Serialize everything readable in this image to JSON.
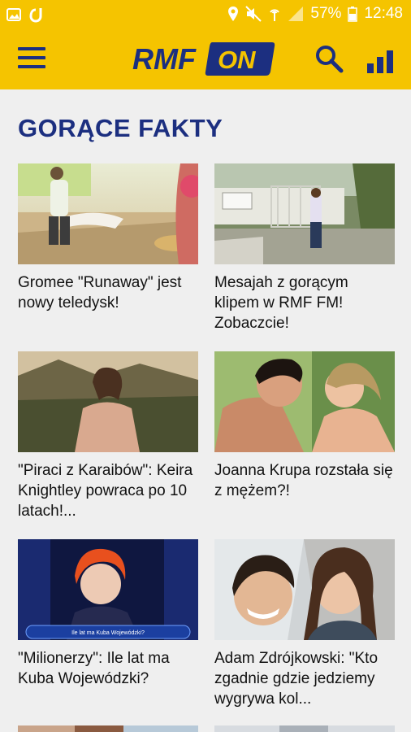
{
  "status_bar": {
    "battery": "57%",
    "time": "12:48"
  },
  "app": {
    "logo_rmf": "RMF",
    "logo_on": "ON",
    "colors": {
      "brand_yellow": "#f5c400",
      "brand_blue": "#1c2f80"
    }
  },
  "section": {
    "title": "GORĄCE FAKTY"
  },
  "articles": [
    {
      "title": "Gromee \"Runaway\" jest nowy teledysk!"
    },
    {
      "title": "Mesajah z gorącym klipem w RMF FM! Zobaczcie!"
    },
    {
      "title": "\"Piraci z Karaibów\": Keira Knightley powraca po 10 latach!..."
    },
    {
      "title": "Joanna Krupa rozstała się z mężem?!"
    },
    {
      "title": "\"Milionerzy\": Ile lat ma Kuba Wojewódzki?"
    },
    {
      "title": "Adam Zdrójkowski: \"Kto zgadnie gdzie jedziemy wygrywa kol..."
    }
  ],
  "quiz_screen_text": "Ile lat ma Kuba Wojewódzki?"
}
